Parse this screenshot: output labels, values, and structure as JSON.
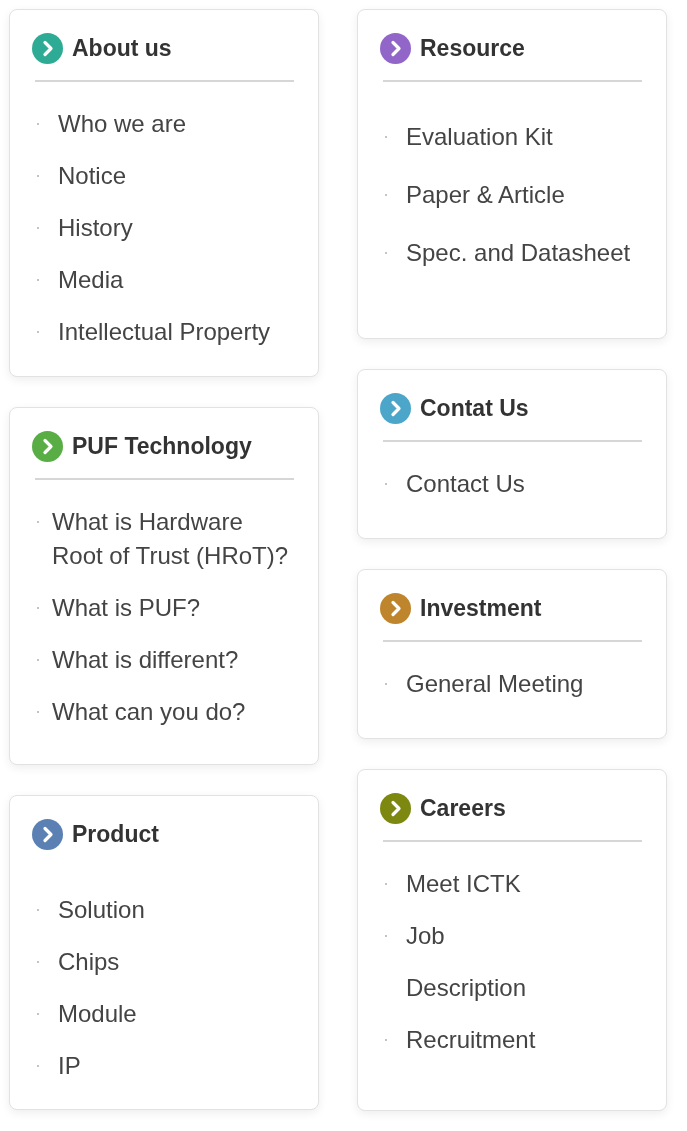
{
  "columns": [
    {
      "cards": [
        {
          "title": "About us",
          "color": "#2eab95",
          "divider": true,
          "items": [
            "Who we are",
            "Notice",
            "History",
            "Media",
            "Intellectual Property"
          ]
        },
        {
          "title": "PUF Technology",
          "color": "#58ad45",
          "divider": true,
          "items": [
            "What is Hardware Root of Trust (HRoT)?",
            "What is PUF?",
            "What is different?",
            "What can you do?"
          ]
        },
        {
          "title": "Product",
          "color": "#5b80b3",
          "divider": false,
          "items": [
            "Solution",
            "Chips",
            "Module",
            "IP"
          ]
        }
      ]
    },
    {
      "cards": [
        {
          "title": "Resource",
          "color": "#9266c8",
          "divider": true,
          "items": [
            "Evaluation Kit",
            "Paper & Article",
            "Spec. and Datasheet"
          ]
        },
        {
          "title": "Contat Us",
          "color": "#4ca6c9",
          "divider": true,
          "items": [
            "Contact Us"
          ]
        },
        {
          "title": "Investment",
          "color": "#bf852c",
          "divider": true,
          "items": [
            "General Meeting"
          ]
        },
        {
          "title": "Careers",
          "color": "#7c880f",
          "divider": true,
          "items": [
            "Meet ICTK",
            "Job\nDescription",
            "Recruitment"
          ]
        }
      ]
    }
  ]
}
